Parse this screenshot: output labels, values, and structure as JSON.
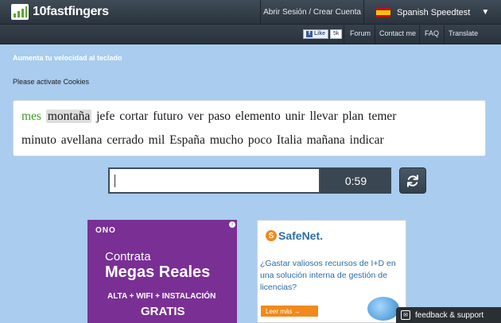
{
  "header": {
    "logo_text": "10fastfingers",
    "signin_label": "Abrir Sesión / Crear Cuenta",
    "language_label": "Spanish Speedtest",
    "tagline": "Aumenta tu velocidad al teclado",
    "fb_like_label": "Like",
    "fb_like_count": "5k",
    "nav": [
      "Forum",
      "Contact me",
      "FAQ",
      "Translate"
    ]
  },
  "main": {
    "cookie_notice": "Please activate Cookies",
    "words_line1": {
      "correct": "mes",
      "current": "montaña",
      "rest": "jefe cortar futuro ver paso elemento unir llevar plan temer"
    },
    "words_line2": "minuto avellana cerrado mil España mucho poco Italia mañana indicar",
    "input_value": "",
    "timer": "0:59"
  },
  "ads": {
    "ad1": {
      "logo": "ONO",
      "line1": "Contrata",
      "line2": "Megas Reales",
      "line3": "ALTA + WIFI + INSTALACIÓN",
      "line4": "GRATIS"
    },
    "ad2": {
      "logo": "SafeNet.",
      "text": "¿Gastar valiosos recursos de I+D en una solución interna de gestión de licencias?",
      "button": "Leer más →"
    }
  },
  "feedback_label": "feedback & support",
  "colors": {
    "background": "#a9ccef",
    "header": "#2b343d",
    "correct_word": "#3a9d23",
    "timer_bg": "#3a4652"
  }
}
